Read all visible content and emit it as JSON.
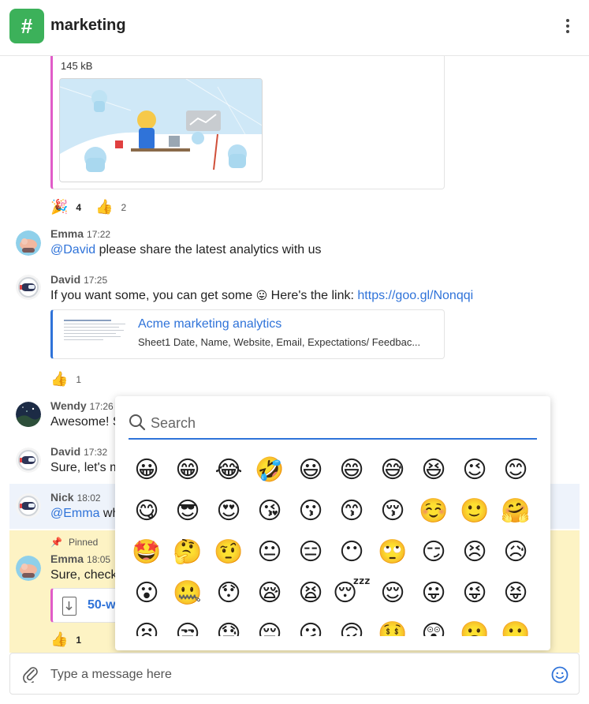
{
  "header": {
    "channel_symbol": "#",
    "channel_name": "marketing",
    "menu_icon": "kebab-menu-icon"
  },
  "attachment": {
    "file_size": "145 kB",
    "reactions": [
      {
        "emoji": "🎉",
        "count": "4"
      },
      {
        "emoji": "👍",
        "count": "2"
      }
    ]
  },
  "messages": [
    {
      "sender": "Emma",
      "time": "17:22",
      "mention": "@David",
      "text": " please share the latest analytics with us"
    },
    {
      "sender": "David",
      "time": "17:25",
      "text_before": "If you want some, you can get some ",
      "inline_emoji": "😛",
      "text_after": " Here's the link: ",
      "link": "https://goo.gl/Nonqqi",
      "link_preview": {
        "title": "Acme marketing analytics",
        "description": "Sheet1 Date, Name, Website, Email, Expectations/ Feedbac..."
      },
      "reactions": [
        {
          "emoji": "👍",
          "count": "1"
        }
      ]
    },
    {
      "sender": "Wendy",
      "time": "17:26",
      "text": "Awesome! S"
    },
    {
      "sender": "David",
      "time": "17:32",
      "text": "Sure, let's m"
    },
    {
      "sender": "Nick",
      "time": "18:02",
      "mention": "@Emma",
      "text": " wh"
    },
    {
      "pinned_label": "Pinned",
      "sender": "Emma",
      "time": "18:05",
      "text": "Sure, check",
      "file_name": "50-wa",
      "reactions": [
        {
          "emoji": "👍",
          "count": "1"
        }
      ]
    }
  ],
  "emoji_picker": {
    "search_placeholder": "Search",
    "emojis": [
      [
        "😀",
        "😁",
        "😂",
        "🤣",
        "😃",
        "😄",
        "😅",
        "😆",
        "😉",
        "😊"
      ],
      [
        "😋",
        "😎",
        "😍",
        "😘",
        "😗",
        "😙",
        "😚",
        "☺️",
        "🙂",
        "🤗"
      ],
      [
        "🤩",
        "🤔",
        "🤨",
        "😐",
        "😑",
        "😶",
        "🙄",
        "😏",
        "😣",
        "😥"
      ],
      [
        "😮",
        "🤐",
        "😯",
        "😪",
        "😫",
        "😴",
        "😌",
        "😛",
        "😜",
        "😝"
      ],
      [
        "😦",
        "😒",
        "😓",
        "😔",
        "😕",
        "🙃",
        "🤑",
        "😲",
        "☹️",
        "🙁"
      ]
    ]
  },
  "composer": {
    "placeholder": "Type a message here"
  }
}
